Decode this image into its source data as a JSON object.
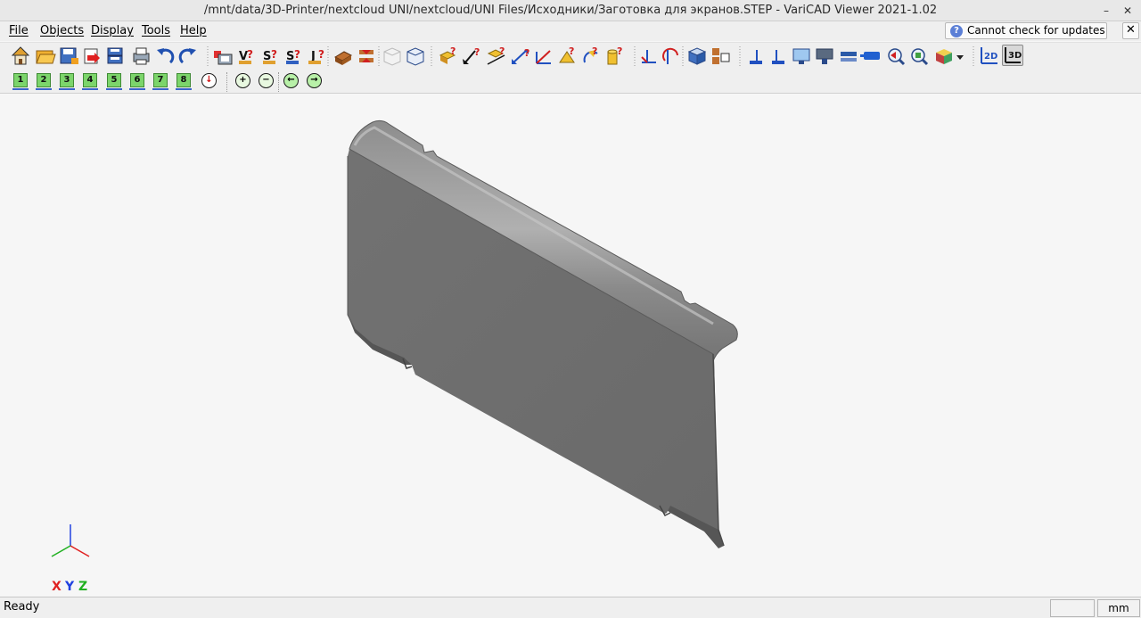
{
  "window": {
    "title": "/mnt/data/3D-Printer/nextcloud UNI/nextcloud/UNI Files/Исходники/Заготовка для экранов.STEP - VariCAD Viewer 2021-1.02",
    "min_glyph": "–",
    "close_glyph": "✕"
  },
  "menu": {
    "items": [
      {
        "label": "File"
      },
      {
        "label": "Objects"
      },
      {
        "label": "Display"
      },
      {
        "label": "Tools"
      },
      {
        "label": "Help"
      }
    ]
  },
  "update": {
    "icon_glyph": "?",
    "label": "Cannot check for updates",
    "close_glyph": "✕"
  },
  "toolbar1": {
    "buttons": [
      {
        "name": "home-icon"
      },
      {
        "name": "open-folder-icon"
      },
      {
        "name": "save-icon"
      },
      {
        "name": "export-icon"
      },
      {
        "name": "batch-save-icon"
      },
      {
        "name": "print-icon"
      },
      {
        "name": "undo-icon"
      },
      {
        "name": "redo-icon"
      },
      {
        "name": "object-info-icon"
      },
      {
        "name": "volume-query-icon"
      },
      {
        "name": "surface-query-icon"
      },
      {
        "name": "area-query-icon"
      },
      {
        "name": "inertia-query-icon"
      },
      {
        "name": "check-interference-icon"
      },
      {
        "name": "split-objects-icon"
      },
      {
        "name": "wireframe-box-icon"
      },
      {
        "name": "shaded-box-icon"
      },
      {
        "name": "object-distance-icon"
      },
      {
        "name": "point-distance-icon"
      },
      {
        "name": "edge-distance-icon"
      },
      {
        "name": "face-distance-icon"
      },
      {
        "name": "vector-measure-icon"
      },
      {
        "name": "angle-measure-icon"
      },
      {
        "name": "arc-measure-icon"
      },
      {
        "name": "cylinder-query-icon"
      },
      {
        "name": "axis-dimension-icon"
      },
      {
        "name": "rotate-dimension-icon"
      },
      {
        "name": "cube-view-icon"
      },
      {
        "name": "multi-view-icon"
      },
      {
        "name": "section-x-icon"
      },
      {
        "name": "section-y-icon"
      },
      {
        "name": "monitor-icon"
      },
      {
        "name": "display-mode-icon"
      },
      {
        "name": "plane-view-icon"
      },
      {
        "name": "blue-tool-icon"
      },
      {
        "name": "zoom-previous-icon"
      },
      {
        "name": "zoom-window-icon"
      },
      {
        "name": "render-mode-icon"
      },
      {
        "name": "view-2d-icon"
      },
      {
        "name": "view-3d-icon"
      }
    ]
  },
  "toolbar2": {
    "views": [
      {
        "label": "1"
      },
      {
        "label": "2"
      },
      {
        "label": "3"
      },
      {
        "label": "4"
      },
      {
        "label": "5"
      },
      {
        "label": "6"
      },
      {
        "label": "7"
      },
      {
        "label": "8"
      }
    ],
    "save_view_glyph": "↓",
    "zoom_glyphs": [
      "+",
      "−"
    ],
    "nav_glyphs": [
      "←",
      "→"
    ]
  },
  "viewport": {
    "axes": {
      "x": "X",
      "y": "Y",
      "z": "Z"
    },
    "colors": {
      "x": "#e02020",
      "y": "#2040e0",
      "z": "#20b020"
    }
  },
  "status": {
    "text": "Ready",
    "coords": "",
    "units": "mm"
  },
  "toolbar_labels": {
    "2d": "2D",
    "3d": "3D"
  }
}
